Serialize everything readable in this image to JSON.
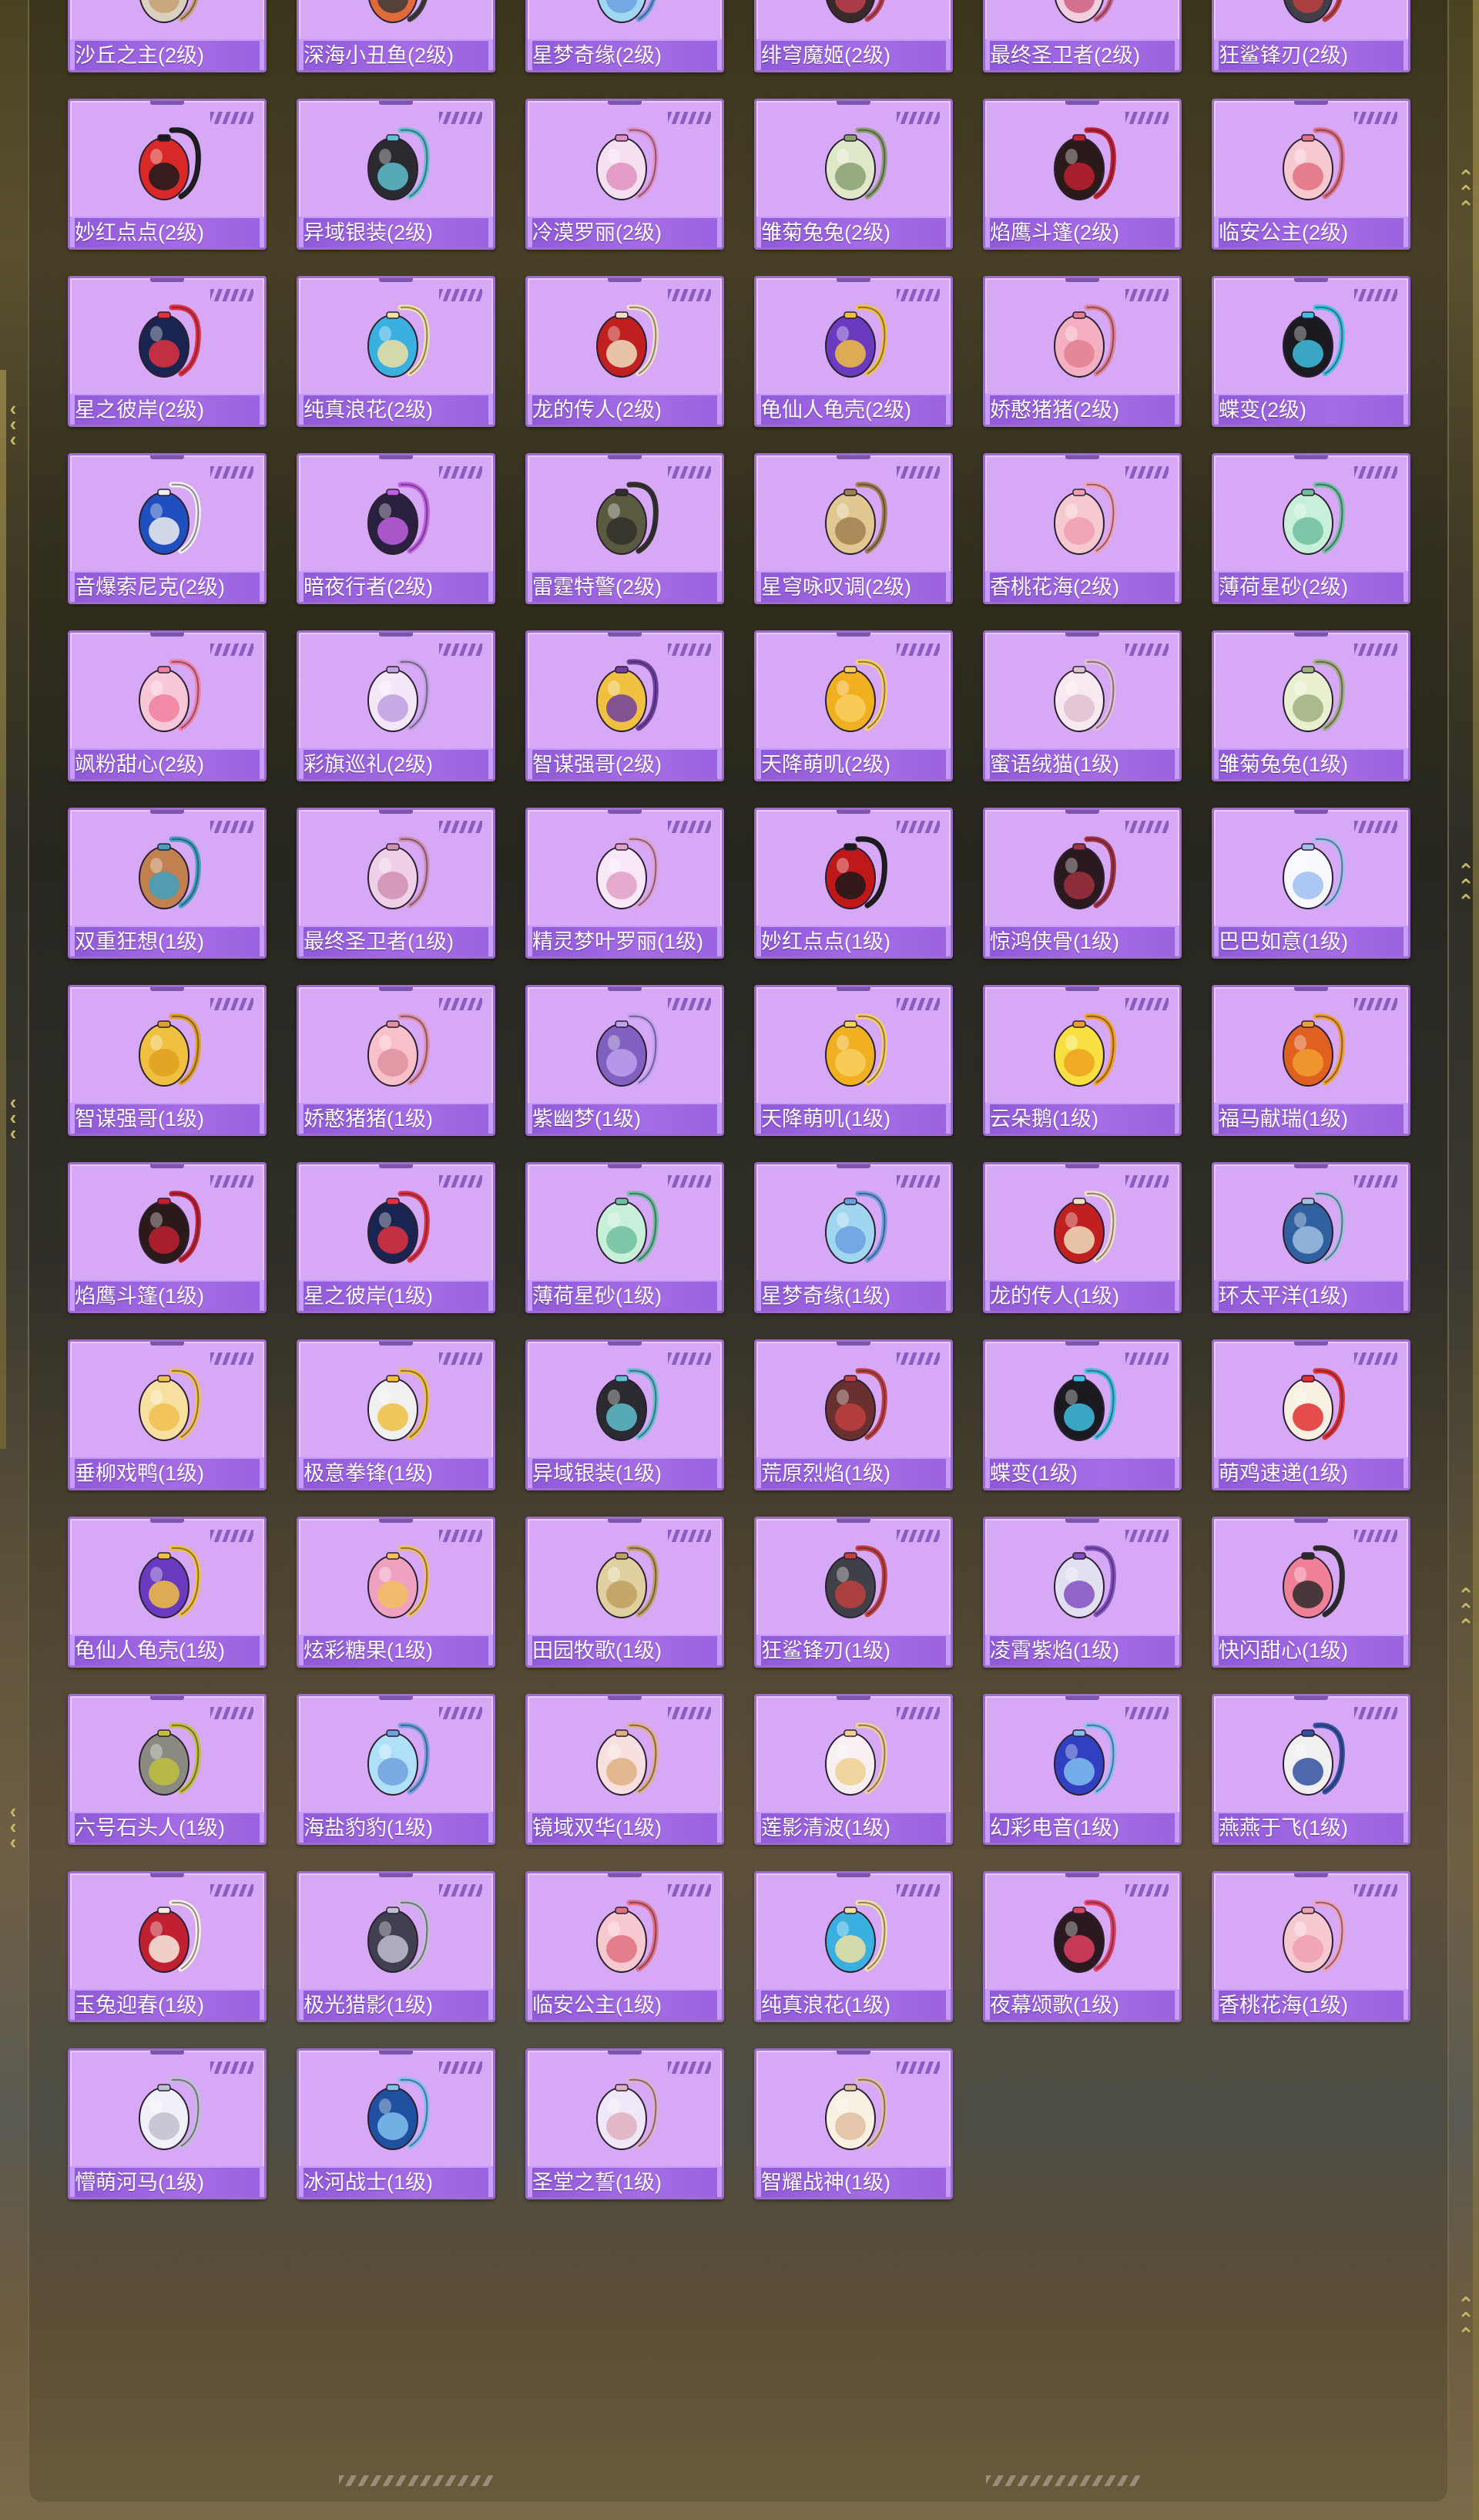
{
  "items": [
    {
      "name": "沙丘之主(2级)",
      "colors": [
        "#d8d0c0",
        "#c8a070"
      ]
    },
    {
      "name": "深海小丑鱼(2级)",
      "colors": [
        "#e06a3c",
        "#3a3a3a"
      ]
    },
    {
      "name": "星梦奇缘(2级)",
      "colors": [
        "#9fd6f0",
        "#6aa0e0"
      ]
    },
    {
      "name": "绯穹魔姬(2级)",
      "colors": [
        "#3a2a2a",
        "#c04050"
      ]
    },
    {
      "name": "最终圣卫者(2级)",
      "colors": [
        "#f0d0e0",
        "#d06080"
      ]
    },
    {
      "name": "狂鲨锋刃(2级)",
      "colors": [
        "#404048",
        "#c04040"
      ]
    },
    {
      "name": "妙红点点(2级)",
      "colors": [
        "#d82828",
        "#1a1a1a"
      ]
    },
    {
      "name": "异域银装(2级)",
      "colors": [
        "#2a2a30",
        "#60c0d0"
      ]
    },
    {
      "name": "冷漠罗丽(2级)",
      "colors": [
        "#f4e0f0",
        "#e090c0"
      ]
    },
    {
      "name": "雏菊兔兔(2级)",
      "colors": [
        "#dfe8c8",
        "#8aa070"
      ]
    },
    {
      "name": "焰鹰斗篷(2级)",
      "colors": [
        "#2a1a1a",
        "#c02030"
      ]
    },
    {
      "name": "临安公主(2级)",
      "colors": [
        "#f6c8d0",
        "#e07080"
      ]
    },
    {
      "name": "星之彼岸(2级)",
      "colors": [
        "#1a2450",
        "#e03040"
      ]
    },
    {
      "name": "纯真浪花(2级)",
      "colors": [
        "#3ab0e0",
        "#f0e0a0"
      ]
    },
    {
      "name": "龙的传人(2级)",
      "colors": [
        "#c02020",
        "#f0e0c0"
      ]
    },
    {
      "name": "龟仙人龟壳(2级)",
      "colors": [
        "#6a3ac0",
        "#f0c040"
      ]
    },
    {
      "name": "娇憨猪猪(2级)",
      "colors": [
        "#f4b0c0",
        "#e08090"
      ]
    },
    {
      "name": "蝶变(2级)",
      "colors": [
        "#1a1a20",
        "#40c0e0"
      ]
    },
    {
      "name": "音爆索尼克(2级)",
      "colors": [
        "#2050c0",
        "#f0f0f0"
      ]
    },
    {
      "name": "暗夜行者(2级)",
      "colors": [
        "#2a2040",
        "#c060e0"
      ]
    },
    {
      "name": "雷霆特警(2级)",
      "colors": [
        "#5a5a40",
        "#30302a"
      ]
    },
    {
      "name": "星穹咏叹调(2级)",
      "colors": [
        "#e0c890",
        "#a08050"
      ]
    },
    {
      "name": "香桃花海(2级)",
      "colors": [
        "#f6c8d0",
        "#f0a0b0"
      ]
    },
    {
      "name": "薄荷星砂(2级)",
      "colors": [
        "#c8f0d8",
        "#70c0a0"
      ]
    },
    {
      "name": "飒粉甜心(2级)",
      "colors": [
        "#f8c8d8",
        "#f080a0"
      ]
    },
    {
      "name": "彩旗巡礼(2级)",
      "colors": [
        "#f4e8f8",
        "#c0a0e0"
      ]
    },
    {
      "name": "智谋强哥(2级)",
      "colors": [
        "#f0c040",
        "#7040a0"
      ]
    },
    {
      "name": "天降萌叽(2级)",
      "colors": [
        "#f0b020",
        "#f8d060"
      ]
    },
    {
      "name": "蜜语绒猫(1级)",
      "colors": [
        "#f8e8f0",
        "#e0c0d0"
      ]
    },
    {
      "name": "雏菊兔兔(1级)",
      "colors": [
        "#e8f0d0",
        "#a0b080"
      ]
    },
    {
      "name": "双重狂想(1级)",
      "colors": [
        "#c08050",
        "#40a0c0"
      ]
    },
    {
      "name": "最终圣卫者(1级)",
      "colors": [
        "#f0d0e8",
        "#d090b0"
      ]
    },
    {
      "name": "精灵梦叶罗丽(1级)",
      "colors": [
        "#f8e8f8",
        "#e0a0c8"
      ]
    },
    {
      "name": "妙红点点(1级)",
      "colors": [
        "#c01818",
        "#1a1a1a"
      ]
    },
    {
      "name": "惊鸿侠骨(1级)",
      "colors": [
        "#2a1a20",
        "#a03040"
      ]
    },
    {
      "name": "巴巴如意(1级)",
      "colors": [
        "#f8f8ff",
        "#a0c0f0"
      ]
    },
    {
      "name": "智谋强哥(1级)",
      "colors": [
        "#f0c040",
        "#e0a020"
      ]
    },
    {
      "name": "娇憨猪猪(1级)",
      "colors": [
        "#f8c0c8",
        "#e090a0"
      ]
    },
    {
      "name": "紫幽梦(1级)",
      "colors": [
        "#8060c0",
        "#c0a0f0"
      ]
    },
    {
      "name": "天降萌叽(1级)",
      "colors": [
        "#f0b020",
        "#f8d060"
      ]
    },
    {
      "name": "云朵鹅(1级)",
      "colors": [
        "#f8e040",
        "#f0a020"
      ]
    },
    {
      "name": "福马献瑞(1级)",
      "colors": [
        "#e06020",
        "#f0a030"
      ]
    },
    {
      "name": "焰鹰斗篷(1级)",
      "colors": [
        "#2a1a1a",
        "#c02030"
      ]
    },
    {
      "name": "星之彼岸(1级)",
      "colors": [
        "#1a2450",
        "#e03040"
      ]
    },
    {
      "name": "薄荷星砂(1级)",
      "colors": [
        "#c8f0d8",
        "#70c0a0"
      ]
    },
    {
      "name": "星梦奇缘(1级)",
      "colors": [
        "#9fd6f0",
        "#6aa0e0"
      ]
    },
    {
      "name": "龙的传人(1级)",
      "colors": [
        "#c02020",
        "#f0e0c0"
      ]
    },
    {
      "name": "环太平洋(1级)",
      "colors": [
        "#3060a0",
        "#a0c0e0"
      ]
    },
    {
      "name": "垂柳戏鸭(1级)",
      "colors": [
        "#f8e0a0",
        "#f0c050"
      ]
    },
    {
      "name": "极意拳锋(1级)",
      "colors": [
        "#f0f0f0",
        "#f0c040"
      ]
    },
    {
      "name": "异域银装(1级)",
      "colors": [
        "#2a2a30",
        "#60c0d0"
      ]
    },
    {
      "name": "荒原烈焰(1级)",
      "colors": [
        "#6a3030",
        "#c04040"
      ]
    },
    {
      "name": "蝶变(1级)",
      "colors": [
        "#1a1a20",
        "#40c0e0"
      ]
    },
    {
      "name": "萌鸡速递(1级)",
      "colors": [
        "#f8f0e0",
        "#e03030"
      ]
    },
    {
      "name": "龟仙人龟壳(1级)",
      "colors": [
        "#6a3ac0",
        "#f0c040"
      ]
    },
    {
      "name": "炫彩糖果(1级)",
      "colors": [
        "#f0a0c0",
        "#f0c060"
      ]
    },
    {
      "name": "田园牧歌(1级)",
      "colors": [
        "#e0d0a0",
        "#c0a060"
      ]
    },
    {
      "name": "狂鲨锋刃(1级)",
      "colors": [
        "#404048",
        "#c04040"
      ]
    },
    {
      "name": "凌霄紫焰(1级)",
      "colors": [
        "#e0e0f0",
        "#8050c0"
      ]
    },
    {
      "name": "快闪甜心(1级)",
      "colors": [
        "#f08098",
        "#2a2a2a"
      ]
    },
    {
      "name": "六号石头人(1级)",
      "colors": [
        "#8a8a80",
        "#c0c040"
      ]
    },
    {
      "name": "海盐豹豹(1级)",
      "colors": [
        "#b0e0f8",
        "#70a0e0"
      ]
    },
    {
      "name": "镜域双华(1级)",
      "colors": [
        "#f8e0e0",
        "#e0b080"
      ]
    },
    {
      "name": "莲影清波(1级)",
      "colors": [
        "#f8f0f0",
        "#f0d090"
      ]
    },
    {
      "name": "幻彩电音(1级)",
      "colors": [
        "#3040c0",
        "#80c0f0"
      ]
    },
    {
      "name": "燕燕于飞(1级)",
      "colors": [
        "#f0f0f0",
        "#3050a0"
      ]
    },
    {
      "name": "玉兔迎春(1级)",
      "colors": [
        "#c02030",
        "#f8f0e0"
      ]
    },
    {
      "name": "极光猎影(1级)",
      "colors": [
        "#404050",
        "#c0c0d0"
      ]
    },
    {
      "name": "临安公主(1级)",
      "colors": [
        "#f6c8d0",
        "#e07080"
      ]
    },
    {
      "name": "纯真浪花(1级)",
      "colors": [
        "#3ab0e0",
        "#f0e0a0"
      ]
    },
    {
      "name": "夜幕颂歌(1级)",
      "colors": [
        "#2a1a20",
        "#e04060"
      ]
    },
    {
      "name": "香桃花海(1级)",
      "colors": [
        "#f6c8d0",
        "#f0a0b0"
      ]
    },
    {
      "name": "懵萌河马(1级)",
      "colors": [
        "#f0f0f8",
        "#c0c0d0"
      ]
    },
    {
      "name": "冰河战士(1级)",
      "colors": [
        "#2050a0",
        "#80c0f0"
      ]
    },
    {
      "name": "圣堂之誓(1级)",
      "colors": [
        "#f0e8f8",
        "#e0b0c0"
      ]
    },
    {
      "name": "智耀战神(1级)",
      "colors": [
        "#f8f0e0",
        "#e0c0a0"
      ]
    }
  ]
}
